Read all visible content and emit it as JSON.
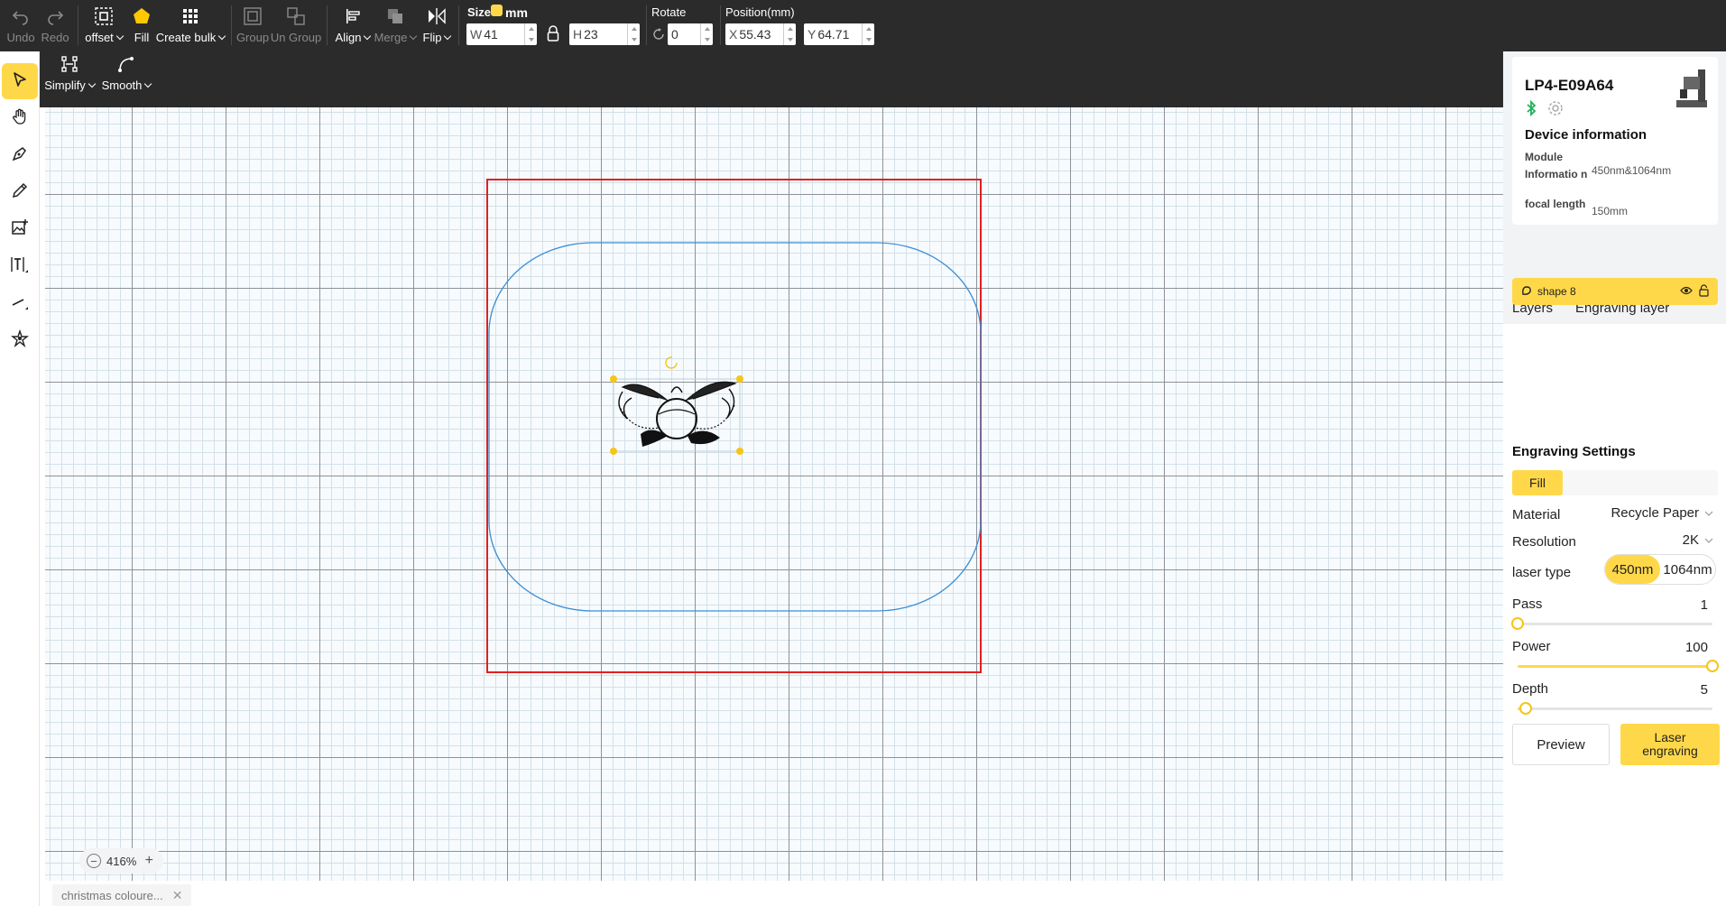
{
  "toolbar": {
    "undo": "Undo",
    "redo": "Redo",
    "offset": "offset",
    "fill": "Fill",
    "create_bulk": "Create bulk",
    "group": "Group",
    "ungroup": "Un Group",
    "align": "Align",
    "merge": "Merge",
    "flip": "Flip",
    "size_label": "Size",
    "unit": "mm",
    "width_prefix": "W",
    "width_value": "41",
    "height_prefix": "H",
    "height_value": "23",
    "rotate_label": "Rotate",
    "rotate_value": "0",
    "position_label": "Position(mm)",
    "x_prefix": "X",
    "x_value": "55.43",
    "y_prefix": "Y",
    "y_value": "64.71"
  },
  "subtoolbar": {
    "simplify": "Simplify",
    "smooth": "Smooth"
  },
  "canvas": {
    "zoom": "416%"
  },
  "file_tab": {
    "name": "christmas coloure..."
  },
  "device": {
    "name": "LP4-E09A64",
    "info_title": "Device information",
    "module_label": "Module Informatio n",
    "module_value": "450nm&1064nm",
    "focal_label": "focal length",
    "focal_value": "150mm"
  },
  "layers": {
    "tab_layers": "Layers",
    "tab_engraving": "Engraving layer",
    "items": [
      {
        "name": "shape 8"
      }
    ]
  },
  "engraving": {
    "title": "Engraving Settings",
    "mode": "Fill",
    "material_label": "Material",
    "material_value": "Recycle Paper",
    "resolution_label": "Resolution",
    "resolution_value": "2K",
    "laser_label": "laser type",
    "laser_opt1": "450nm",
    "laser_opt2": "1064nm",
    "pass_label": "Pass",
    "pass_value": "1",
    "pass_level": 0.0,
    "power_label": "Power",
    "power_value": "100",
    "power_level": 1.0,
    "depth_label": "Depth",
    "depth_value": "5",
    "depth_level": 0.04,
    "preview_btn": "Preview",
    "laser_btn": "Laser engraving"
  },
  "colors": {
    "accent": "#ffd84a",
    "toolbar_bg": "#2b2b2b",
    "work_area": "#e02020",
    "outline": "#3a8fd6"
  }
}
